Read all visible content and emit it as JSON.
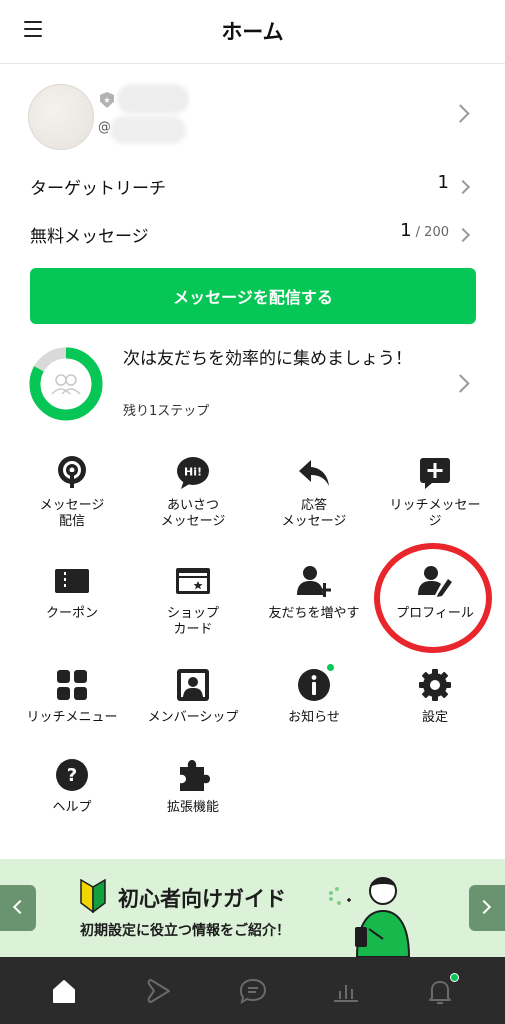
{
  "header": {
    "title": "ホーム"
  },
  "account": {
    "at": "@"
  },
  "stats": [
    {
      "label": "ターゲットリーチ",
      "value": "1",
      "total": ""
    },
    {
      "label": "無料メッセージ",
      "value": "1",
      "total": " / 200"
    }
  ],
  "cta": {
    "label": "メッセージを配信する"
  },
  "progress": {
    "title": "次は友だちを効率的に集めましょう！",
    "remaining": "残り1ステップ",
    "fraction": 0.83,
    "color": "#06c755"
  },
  "menu": [
    {
      "label": "メッセージ\n配信",
      "icon": "broadcast-icon"
    },
    {
      "label": "あいさつ\nメッセージ",
      "icon": "hi-chat-icon"
    },
    {
      "label": "応答\nメッセージ",
      "icon": "reply-arrow-icon"
    },
    {
      "label": "リッチメッセー\nジ",
      "icon": "rich-message-icon"
    },
    {
      "label": "クーポン",
      "icon": "coupon-icon"
    },
    {
      "label": "ショップ\nカード",
      "icon": "shop-card-icon"
    },
    {
      "label": "友だちを増やす",
      "icon": "add-friend-icon"
    },
    {
      "label": "プロフィール",
      "icon": "profile-edit-icon"
    },
    {
      "label": "リッチメニュー",
      "icon": "rich-menu-icon"
    },
    {
      "label": "メンバーシップ",
      "icon": "membership-icon"
    },
    {
      "label": "お知らせ",
      "icon": "info-icon"
    },
    {
      "label": "設定",
      "icon": "gear-icon"
    },
    {
      "label": "ヘルプ",
      "icon": "help-icon"
    },
    {
      "label": "拡張機能",
      "icon": "puzzle-icon"
    }
  ],
  "banner": {
    "title": "初心者向けガイド",
    "subtitle": "初期設定に役立つ情報をご紹介！"
  },
  "nav": [
    {
      "icon": "home-icon",
      "active": true
    },
    {
      "icon": "play-icon",
      "active": false
    },
    {
      "icon": "chat-icon",
      "active": false
    },
    {
      "icon": "analytics-icon",
      "active": false
    },
    {
      "icon": "bell-icon",
      "active": false
    }
  ],
  "colors": {
    "brand": "#06c755",
    "highlight": "#e8262b",
    "nav_bg": "#2b2b2b"
  }
}
